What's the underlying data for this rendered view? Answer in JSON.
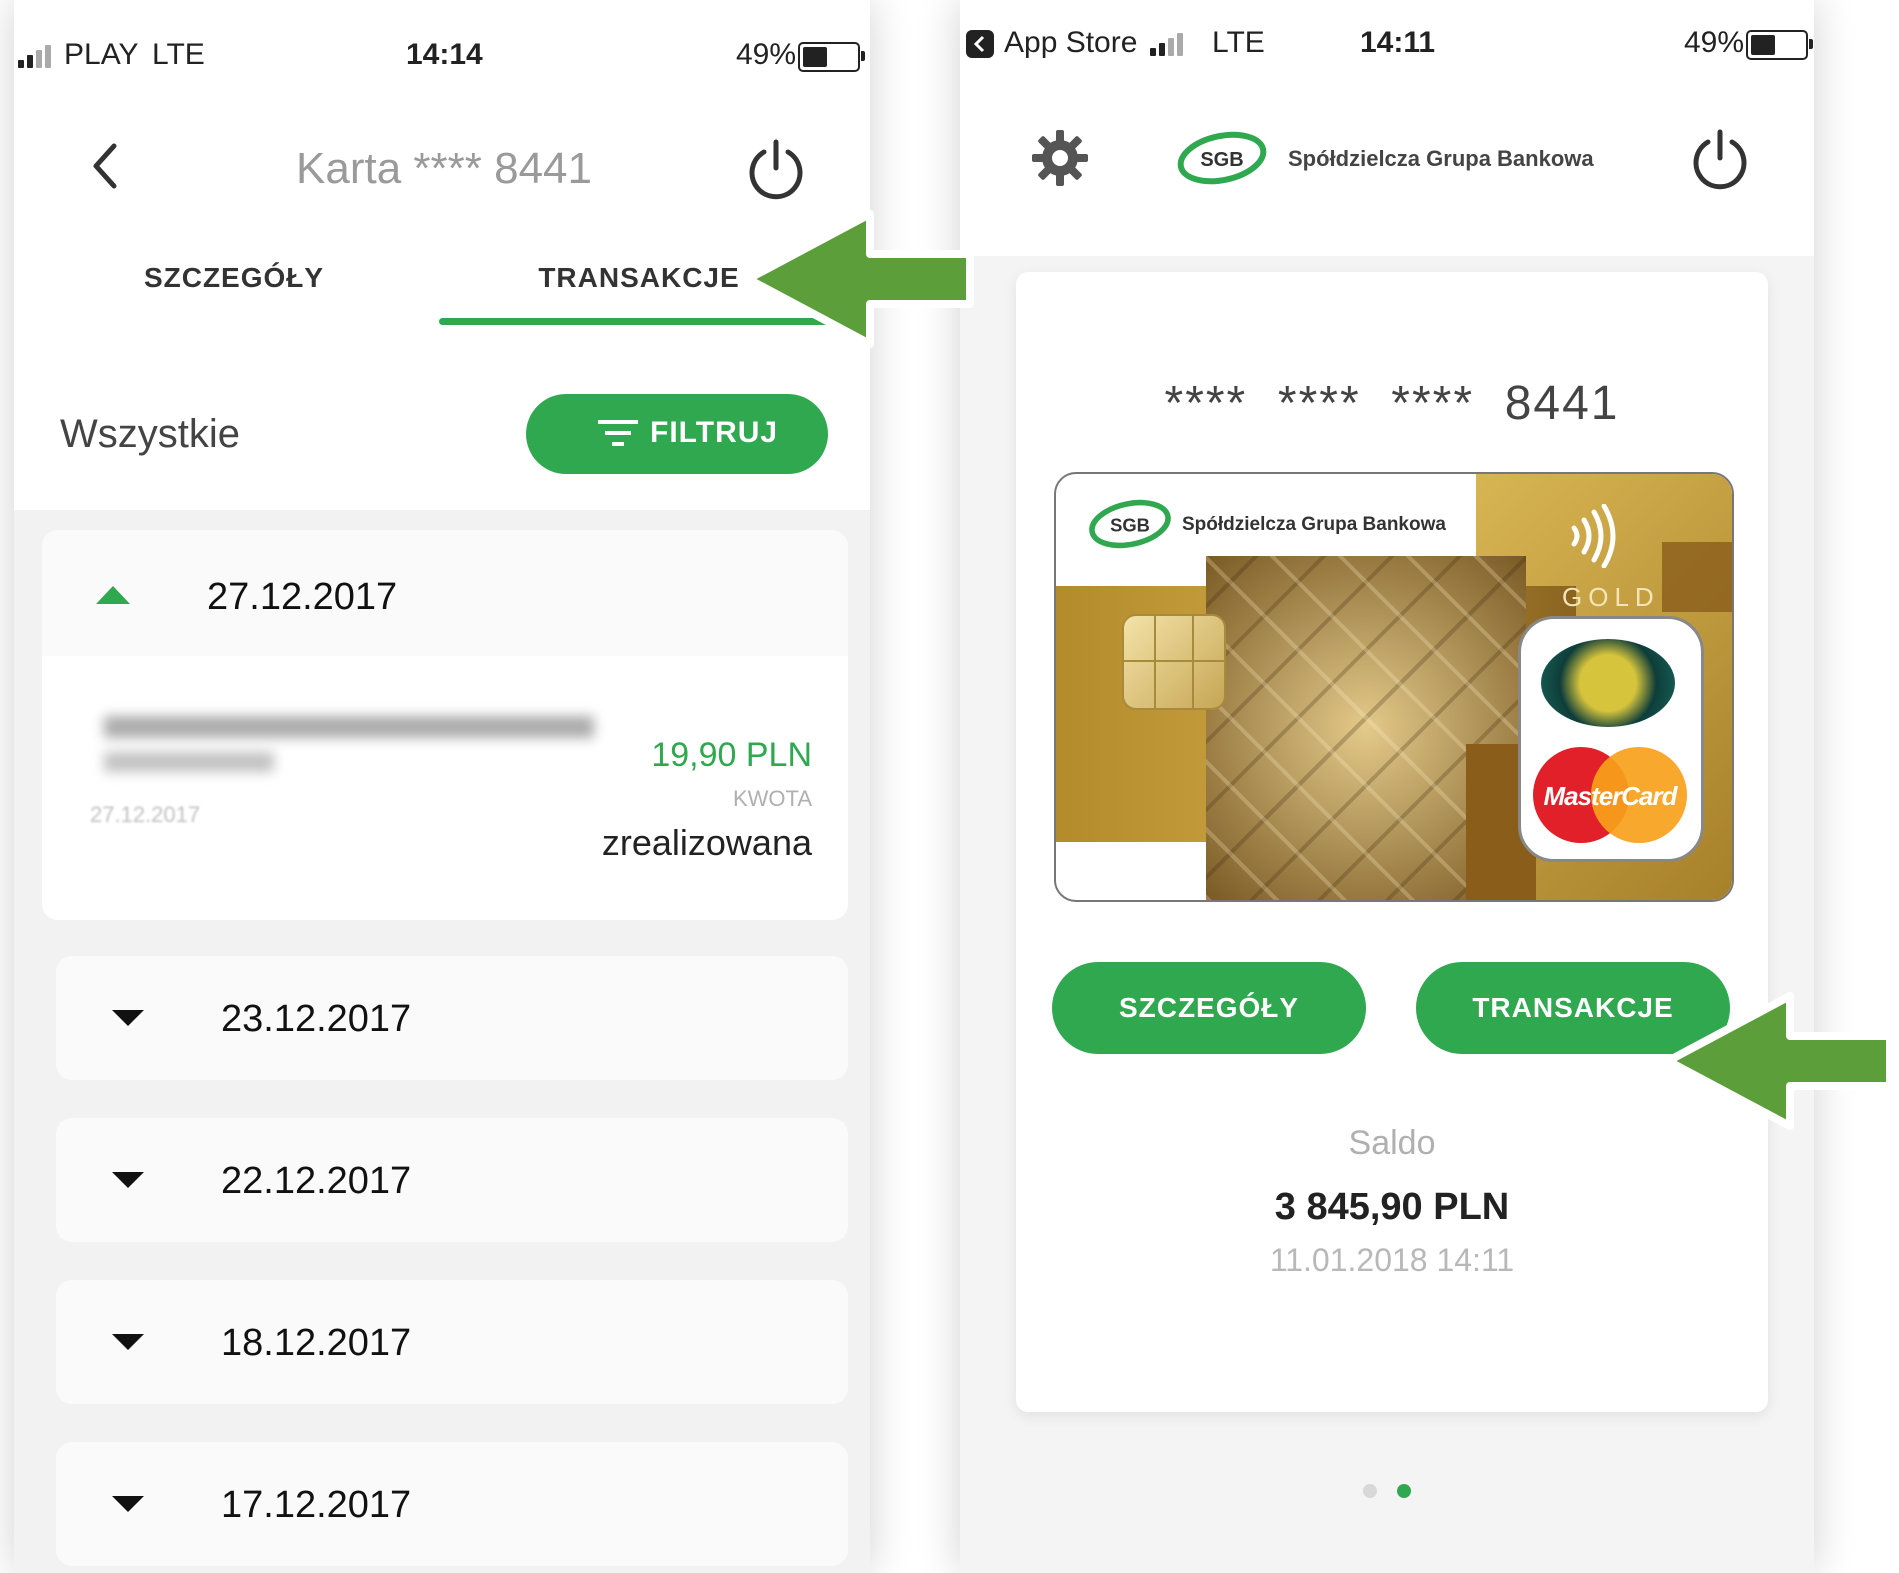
{
  "left_screen": {
    "status": {
      "carrier": "PLAY",
      "network": "LTE",
      "time": "14:14",
      "battery": "49%"
    },
    "header": {
      "title": "Karta **** 8441"
    },
    "tabs": [
      {
        "label": "SZCZEGÓŁY"
      },
      {
        "label": "TRANSAKCJE"
      }
    ],
    "filter": {
      "label": "Wszystkie",
      "button_label": "FILTRUJ"
    },
    "expanded_group": {
      "date": "27.12.2017",
      "transaction": {
        "amount": "19,90 PLN",
        "amount_caption": "KWOTA",
        "date": "27.12.2017",
        "status": "zrealizowana"
      }
    },
    "collapsed_groups": [
      {
        "date": "23.12.2017"
      },
      {
        "date": "22.12.2017"
      },
      {
        "date": "18.12.2017"
      },
      {
        "date": "17.12.2017"
      }
    ]
  },
  "right_screen": {
    "status": {
      "back_app": "App Store",
      "network": "LTE",
      "time": "14:11",
      "battery": "49%"
    },
    "header": {
      "logo_abbr": "SGB",
      "bank_name": "Spółdzielcza Grupa Bankowa"
    },
    "card": {
      "masked_number": "****  ****  ****  8441",
      "logo_abbr": "SGB",
      "bank_name": "Spółdzielcza Grupa Bankowa",
      "tier": "GOLD",
      "network": "MasterCard"
    },
    "buttons": {
      "details_label": "SZCZEGÓŁY",
      "transactions_label": "TRANSAKCJE"
    },
    "balance": {
      "label": "Saldo",
      "amount": "3 845,90 PLN",
      "timestamp": "11.01.2018 14:11"
    },
    "pager": {
      "count": 2,
      "active": 2
    }
  },
  "icons": {
    "back": "chevron-left-icon",
    "power": "power-icon",
    "settings": "gear-icon",
    "filter": "filter-lines-icon",
    "expand": "triangle-down-icon",
    "collapse": "triangle-up-icon",
    "contactless": "contactless-icon",
    "chip": "chip-icon",
    "pointer": "arrow-left-icon"
  },
  "colors": {
    "accent_green": "#2fa84f",
    "arrow_green": "#5b9e3a",
    "gold": "#b8902a",
    "text_dark": "#222222",
    "text_gray": "#9a9a9a"
  }
}
